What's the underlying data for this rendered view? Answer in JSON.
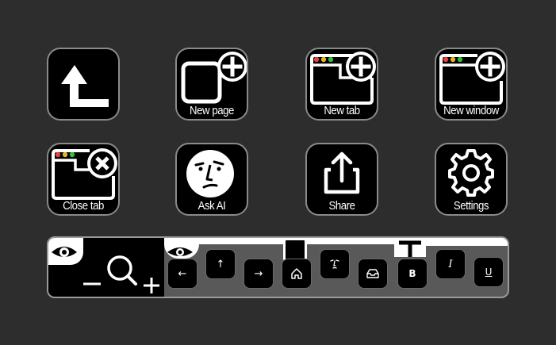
{
  "tiles": [
    {
      "id": "back",
      "label": "",
      "icon": "return-arrow-icon"
    },
    {
      "id": "new_page",
      "label": "New page",
      "icon": "new-page-icon"
    },
    {
      "id": "new_tab",
      "label": "New tab",
      "icon": "new-tab-icon"
    },
    {
      "id": "new_window",
      "label": "New window",
      "icon": "new-window-icon"
    },
    {
      "id": "close_tab",
      "label": "Close tab",
      "icon": "close-tab-icon"
    },
    {
      "id": "ask_ai",
      "label": "Ask AI",
      "icon": "ai-face-icon"
    },
    {
      "id": "share",
      "label": "Share",
      "icon": "share-icon"
    },
    {
      "id": "settings",
      "label": "Settings",
      "icon": "gear-icon"
    }
  ],
  "toolbar": {
    "zoom_icons": [
      "eye-icon",
      "zoom-out-icon",
      "magnifier-icon",
      "zoom-in-icon"
    ],
    "keys": [
      {
        "name": "arrow-left-key",
        "icon": "arrow-left-icon",
        "text": "←"
      },
      {
        "name": "arrow-up-key",
        "icon": "arrow-up-icon",
        "text": "↑"
      },
      {
        "name": "arrow-right-key",
        "icon": "arrow-right-icon",
        "text": "→"
      },
      {
        "name": "home-key",
        "icon": "home-icon",
        "text": ""
      },
      {
        "name": "ai-key",
        "icon": "ai-face-icon",
        "text": ""
      },
      {
        "name": "inbox-key",
        "icon": "inbox-icon",
        "text": ""
      },
      {
        "name": "bold-key",
        "icon": "",
        "text": "B"
      },
      {
        "name": "italic-key",
        "icon": "",
        "text": "I"
      },
      {
        "name": "underline-key",
        "icon": "",
        "text": "U"
      }
    ]
  },
  "colors": {
    "background": "#2d2d2d",
    "tile": "#000000",
    "traffic_red": "#e0443e",
    "traffic_yellow": "#e6b422",
    "traffic_green": "#2fbf3f"
  }
}
